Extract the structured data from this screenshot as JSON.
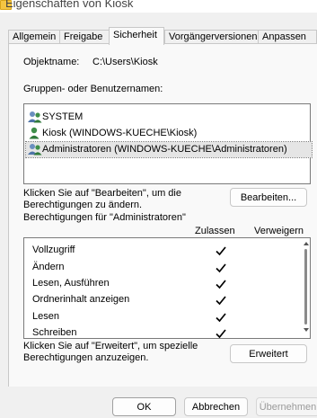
{
  "window": {
    "title": "Eigenschaften von Kiosk",
    "title_icon": "folder-icon"
  },
  "tabs": [
    {
      "label": "Allgemein",
      "active": false
    },
    {
      "label": "Freigabe",
      "active": false
    },
    {
      "label": "Sicherheit",
      "active": true
    },
    {
      "label": "Vorgängerversionen",
      "active": false
    },
    {
      "label": "Anpassen",
      "active": false
    }
  ],
  "security": {
    "object_label": "Objektname:",
    "object_value": "C:\\Users\\Kiosk",
    "groups_label": "Gruppen- oder Benutzernamen:",
    "principals": [
      {
        "name": "SYSTEM",
        "icon": "group-icon"
      },
      {
        "name": "Kiosk (WINDOWS-KUECHE\\Kiosk)",
        "icon": "user-icon"
      },
      {
        "name": "Administratoren (WINDOWS-KUECHE\\Administratoren)",
        "icon": "group-icon",
        "selected": true
      }
    ],
    "edit_hint": "Klicken Sie auf \"Bearbeiten\", um die Berechtigungen zu ändern.",
    "edit_hint_line1": "Klicken Sie auf \"Bearbeiten\", um die",
    "edit_hint_line2": "Berechtigungen zu ändern.",
    "edit_button": "Bearbeiten...",
    "permissions_for": "Berechtigungen für \"Administratoren\"",
    "col_allow": "Zulassen",
    "col_deny": "Verweigern",
    "permissions": [
      {
        "name": "Vollzugriff",
        "allow": true,
        "deny": false
      },
      {
        "name": "Ändern",
        "allow": true,
        "deny": false
      },
      {
        "name": "Lesen, Ausführen",
        "allow": true,
        "deny": false
      },
      {
        "name": "Ordnerinhalt anzeigen",
        "allow": true,
        "deny": false
      },
      {
        "name": "Lesen",
        "allow": true,
        "deny": false
      },
      {
        "name": "Schreiben",
        "allow": true,
        "deny": false
      }
    ],
    "advanced_hint_line1": "Klicken Sie auf \"Erweitert\", um spezielle",
    "advanced_hint_line2": "Berechtigungen anzuzeigen.",
    "advanced_button": "Erweitert"
  },
  "footer": {
    "ok": "OK",
    "cancel": "Abbrechen",
    "apply": "Übernehmen"
  },
  "colors": {
    "dialog_bg": "#f0f0f0",
    "panel_bg": "#f9f9f9",
    "selection": "#e5e5e5",
    "disabled_text": "#9a9a9a"
  }
}
